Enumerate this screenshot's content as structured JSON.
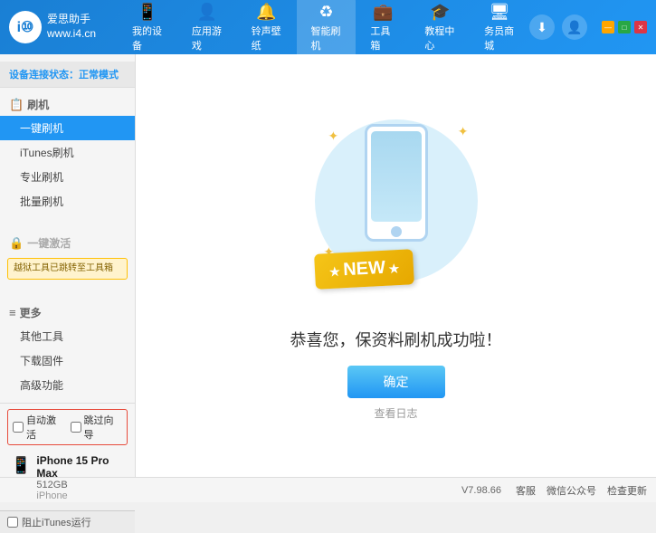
{
  "header": {
    "logo_text_line1": "爱思助手",
    "logo_text_line2": "www.i4.cn",
    "logo_symbol": "i⑩",
    "nav_tabs": [
      {
        "id": "my-device",
        "icon": "📱",
        "label": "我的设备"
      },
      {
        "id": "apps-games",
        "icon": "👤",
        "label": "应用游戏"
      },
      {
        "id": "ringtones",
        "icon": "🔔",
        "label": "铃声壁纸"
      },
      {
        "id": "smart-flash",
        "icon": "♻",
        "label": "智能刷机"
      },
      {
        "id": "tools",
        "icon": "💼",
        "label": "工具箱"
      },
      {
        "id": "tutorials",
        "icon": "🎓",
        "label": "教程中心"
      },
      {
        "id": "service",
        "icon": "🖥",
        "label": "务员商城"
      }
    ],
    "download_icon": "⬇",
    "user_icon": "👤",
    "win_controls": {
      "minimize": "—",
      "maximize": "□",
      "close": "✕"
    }
  },
  "sidebar": {
    "status_label": "设备连接状态：",
    "status_value": "正常模式",
    "sections": [
      {
        "id": "flash",
        "icon": "📋",
        "label": "刷机",
        "items": [
          {
            "id": "one-key-flash",
            "label": "一键刷机",
            "active": true
          },
          {
            "id": "itunes-flash",
            "label": "iTunes刷机"
          },
          {
            "id": "pro-flash",
            "label": "专业刷机"
          },
          {
            "id": "batch-flash",
            "label": "批量刷机"
          }
        ]
      },
      {
        "id": "one-key-activate",
        "icon": "🔒",
        "label": "一键激活",
        "disabled": true,
        "warning": "越狱工具已跳转至工具箱"
      },
      {
        "id": "more",
        "icon": "≡",
        "label": "更多",
        "items": [
          {
            "id": "other-tools",
            "label": "其他工具"
          },
          {
            "id": "download-firmware",
            "label": "下载固件"
          },
          {
            "id": "advanced",
            "label": "高级功能"
          }
        ]
      }
    ],
    "bottom": {
      "auto_activate_label": "自动激活",
      "guide_activate_label": "跳过向导",
      "device_icon": "📱",
      "device_name": "iPhone 15 Pro Max",
      "device_storage": "512GB",
      "device_type": "iPhone"
    },
    "footer": {
      "checkbox_label": "阻止iTunes运行"
    }
  },
  "content": {
    "new_badge": "NEW",
    "success_message": "恭喜您，保资料刷机成功啦！",
    "confirm_button": "确定",
    "view_log_link": "查看日志"
  },
  "statusbar": {
    "version": "V7.98.66",
    "links": [
      {
        "id": "customer-service",
        "label": "客服"
      },
      {
        "id": "wechat",
        "label": "微信公众号"
      },
      {
        "id": "check-update",
        "label": "检查更新"
      }
    ]
  }
}
